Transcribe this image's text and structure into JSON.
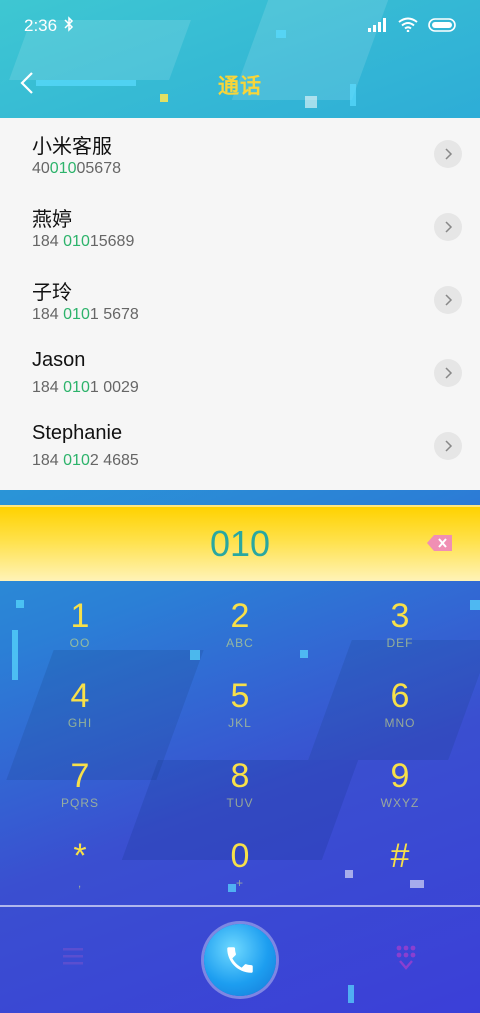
{
  "status_bar": {
    "time": "2:36",
    "icons": [
      "bluetooth-icon",
      "signal-icon",
      "wifi-icon",
      "battery-icon"
    ]
  },
  "header": {
    "title": "通话",
    "back_icon": "chevron-left-icon"
  },
  "contacts": [
    {
      "name": "小米客服",
      "number_pre": "40",
      "number_match": "010",
      "number_post": "05678"
    },
    {
      "name": "燕婷",
      "number_pre": "184 ",
      "number_match": "010",
      "number_post": "15689"
    },
    {
      "name": "子玲",
      "number_pre": "184 ",
      "number_match": "010",
      "number_post": "1 5678"
    },
    {
      "name": "Jason",
      "number_pre": "184 ",
      "number_match": "010",
      "number_post": "1 0029"
    },
    {
      "name": "Stephanie",
      "number_pre": "184 ",
      "number_match": "010",
      "number_post": "2 4685"
    }
  ],
  "input": {
    "digits": "010",
    "backspace_icon": "backspace-icon"
  },
  "keypad": {
    "keys": [
      {
        "digit": "1",
        "letters": "OO"
      },
      {
        "digit": "2",
        "letters": "ABC"
      },
      {
        "digit": "3",
        "letters": "DEF"
      },
      {
        "digit": "4",
        "letters": "GHI"
      },
      {
        "digit": "5",
        "letters": "JKL"
      },
      {
        "digit": "6",
        "letters": "MNO"
      },
      {
        "digit": "7",
        "letters": "PQRS"
      },
      {
        "digit": "8",
        "letters": "TUV"
      },
      {
        "digit": "9",
        "letters": "WXYZ"
      },
      {
        "digit": "*",
        "letters": ","
      },
      {
        "digit": "0",
        "letters": "+"
      },
      {
        "digit": "#",
        "letters": ""
      }
    ]
  },
  "bottom_bar": {
    "menu_icon": "menu-icon",
    "call_icon": "phone-icon",
    "dialpad_icon": "dialpad-collapse-icon"
  },
  "colors": {
    "title": "#f7d53a",
    "match_highlight": "#2db36b",
    "keypad_digit": "#f7e04a",
    "input_digits": "#2aa7a0",
    "input_bar": "#ffd200"
  }
}
